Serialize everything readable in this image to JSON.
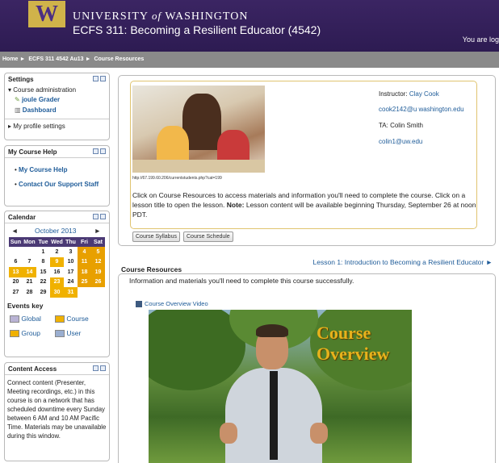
{
  "header": {
    "logo_letter": "W",
    "university": "UNIVERSITY",
    "of": "of",
    "washington": "WASHINGTON",
    "course_title": "ECFS 311: Becoming a Resilient Educator (4542)",
    "logged_in": "You are log"
  },
  "breadcrumb": [
    "Home",
    "ECFS 311 4542 Au13",
    "Course Resources"
  ],
  "settings": {
    "title": "Settings",
    "course_admin": "Course administration",
    "items": [
      "joule Grader",
      "Dashboard"
    ],
    "profile": "My profile settings"
  },
  "help": {
    "title": "My Course Help",
    "items": [
      "My Course Help",
      "Contact Our Support Staff"
    ]
  },
  "calendar": {
    "title": "Calendar",
    "month": "October 2013",
    "prev": "◄",
    "next": "►",
    "days": [
      "Sun",
      "Mon",
      "Tue",
      "Wed",
      "Thu",
      "Fri",
      "Sat"
    ],
    "weeks": [
      [
        "",
        "",
        "1",
        "2",
        "3",
        "4",
        "5"
      ],
      [
        "6",
        "7",
        "8",
        "9",
        "10",
        "11",
        "12"
      ],
      [
        "13",
        "14",
        "15",
        "16",
        "17",
        "18",
        "19"
      ],
      [
        "20",
        "21",
        "22",
        "23",
        "24",
        "25",
        "26"
      ],
      [
        "27",
        "28",
        "29",
        "30",
        "31",
        "",
        ""
      ]
    ],
    "events_key_title": "Events key",
    "events_key": [
      "Global",
      "Course",
      "Group",
      "User"
    ],
    "event_color": "#f0b100",
    "weekend_event_color": "#e8a000"
  },
  "content_access": {
    "title": "Content Access",
    "text": "Connect content (Presenter, Meeting recordings, etc.) in this course is on a network that has scheduled downtime every Sunday between 6 AM and 10 AM Pacific Time. Materials may be unavailable during this window."
  },
  "intro": {
    "photo_caption": "http://67.199.60.206/currentstudents.php?cat=199",
    "instructor_label": "Instructor:",
    "instructor_name": "Clay Cook",
    "instructor_email": "cook2142@u washington.edu",
    "ta_label": "TA: Colin Smith",
    "ta_email": "colin1@uw.edu",
    "desc_before": "Click on Course Resources to access materials and information you'll need to complete the course. Click on a lesson title to open the lesson.",
    "note_label": "Note:",
    "desc_after": "Lesson content will be available beginning Thursday, September 26 at noon PDT."
  },
  "buttons": {
    "syllabus": "Course Syllabus",
    "schedule": "Course Schedule"
  },
  "resources": {
    "title": "Course Resources",
    "lesson_link": "Lesson 1: Introduction to Becoming a Resilient Educator ►",
    "description": "Information and materials you'll need to complete this course successfully.",
    "video_link": "Course Overview Video",
    "video_title_1": "Course",
    "video_title_2": "Overview"
  }
}
